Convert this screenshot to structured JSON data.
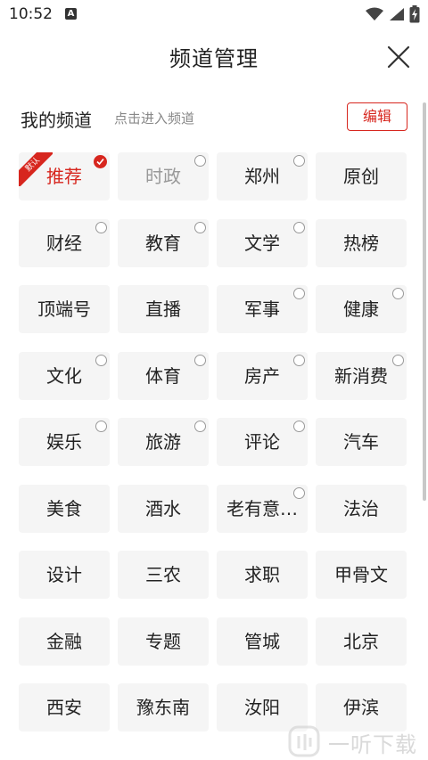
{
  "status_bar": {
    "time": "10:52",
    "notification_letter": "A"
  },
  "header": {
    "title": "频道管理"
  },
  "section": {
    "title": "我的频道",
    "hint": "点击进入频道",
    "edit_label": "编辑"
  },
  "accent_color": "#d7261e",
  "channels": [
    {
      "label": "推荐",
      "state": "active",
      "badge": "check",
      "ribbon": "默认"
    },
    {
      "label": "时政",
      "state": "muted",
      "badge": "radio"
    },
    {
      "label": "郑州",
      "state": "normal",
      "badge": "radio"
    },
    {
      "label": "原创",
      "state": "normal",
      "badge": "none"
    },
    {
      "label": "财经",
      "state": "normal",
      "badge": "radio"
    },
    {
      "label": "教育",
      "state": "normal",
      "badge": "radio"
    },
    {
      "label": "文学",
      "state": "normal",
      "badge": "radio"
    },
    {
      "label": "热榜",
      "state": "normal",
      "badge": "none"
    },
    {
      "label": "顶端号",
      "state": "normal",
      "badge": "none"
    },
    {
      "label": "直播",
      "state": "normal",
      "badge": "none"
    },
    {
      "label": "军事",
      "state": "normal",
      "badge": "radio"
    },
    {
      "label": "健康",
      "state": "normal",
      "badge": "radio"
    },
    {
      "label": "文化",
      "state": "normal",
      "badge": "radio"
    },
    {
      "label": "体育",
      "state": "normal",
      "badge": "radio"
    },
    {
      "label": "房产",
      "state": "normal",
      "badge": "radio"
    },
    {
      "label": "新消费",
      "state": "normal",
      "badge": "radio"
    },
    {
      "label": "娱乐",
      "state": "normal",
      "badge": "radio"
    },
    {
      "label": "旅游",
      "state": "normal",
      "badge": "radio"
    },
    {
      "label": "评论",
      "state": "normal",
      "badge": "radio"
    },
    {
      "label": "汽车",
      "state": "normal",
      "badge": "none"
    },
    {
      "label": "美食",
      "state": "normal",
      "badge": "none"
    },
    {
      "label": "酒水",
      "state": "normal",
      "badge": "none"
    },
    {
      "label": "老有意…",
      "state": "normal",
      "badge": "radio"
    },
    {
      "label": "法治",
      "state": "normal",
      "badge": "none"
    },
    {
      "label": "设计",
      "state": "normal",
      "badge": "none"
    },
    {
      "label": "三农",
      "state": "normal",
      "badge": "none"
    },
    {
      "label": "求职",
      "state": "normal",
      "badge": "none"
    },
    {
      "label": "甲骨文",
      "state": "normal",
      "badge": "none"
    },
    {
      "label": "金融",
      "state": "normal",
      "badge": "none"
    },
    {
      "label": "专题",
      "state": "normal",
      "badge": "none"
    },
    {
      "label": "管城",
      "state": "normal",
      "badge": "none"
    },
    {
      "label": "北京",
      "state": "normal",
      "badge": "none"
    },
    {
      "label": "西安",
      "state": "normal",
      "badge": "none"
    },
    {
      "label": "豫东南",
      "state": "normal",
      "badge": "none"
    },
    {
      "label": "汝阳",
      "state": "normal",
      "badge": "none"
    },
    {
      "label": "伊滨",
      "state": "normal",
      "badge": "none"
    }
  ],
  "watermark": {
    "text": "一听下载"
  }
}
